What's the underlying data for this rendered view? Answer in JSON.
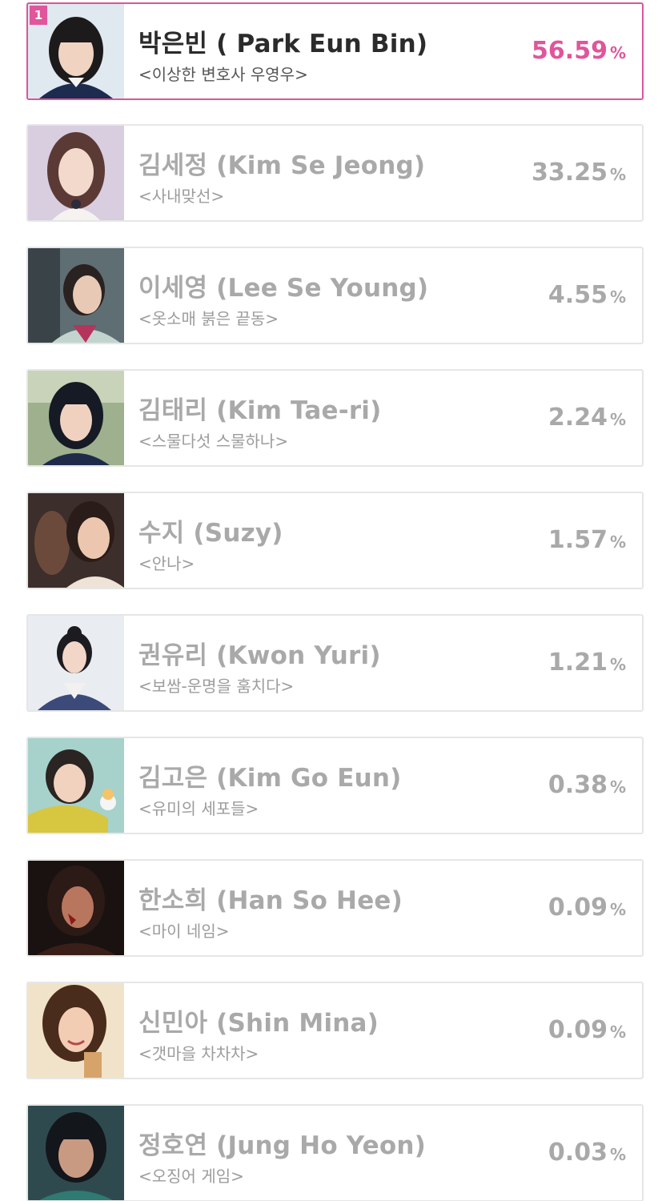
{
  "accent_color": "#e0559c",
  "rank_badge": "1",
  "entries": [
    {
      "name": "박은빈 ( Park Eun Bin)",
      "drama": "<이상한 변호사 우영우>",
      "percent": "56.59",
      "unit": "%",
      "photo": "photo-park-eun-bin"
    },
    {
      "name": "김세정 (Kim Se Jeong)",
      "drama": "<사내맞선>",
      "percent": "33.25",
      "unit": "%",
      "photo": "photo-kim-se-jeong"
    },
    {
      "name": "이세영 (Lee Se Young)",
      "drama": "<옷소매 붉은 끝동>",
      "percent": "4.55",
      "unit": "%",
      "photo": "photo-lee-se-young"
    },
    {
      "name": "김태리 (Kim Tae-ri)",
      "drama": "<스물다섯 스물하나>",
      "percent": "2.24",
      "unit": "%",
      "photo": "photo-kim-tae-ri"
    },
    {
      "name": "수지 (Suzy)",
      "drama": "<안나>",
      "percent": "1.57",
      "unit": "%",
      "photo": "photo-suzy"
    },
    {
      "name": "권유리 (Kwon Yuri)",
      "drama": "<보쌈-운명을 훔치다>",
      "percent": "1.21",
      "unit": "%",
      "photo": "photo-kwon-yuri"
    },
    {
      "name": "김고은 (Kim Go Eun)",
      "drama": "<유미의 세포들>",
      "percent": "0.38",
      "unit": "%",
      "photo": "photo-kim-go-eun"
    },
    {
      "name": "한소희 (Han So Hee)",
      "drama": "<마이 네임>",
      "percent": "0.09",
      "unit": "%",
      "photo": "photo-han-so-hee"
    },
    {
      "name": "신민아 (Shin Mina)",
      "drama": "<갯마을 차차차>",
      "percent": "0.09",
      "unit": "%",
      "photo": "photo-shin-mina"
    },
    {
      "name": "정호연 (Jung Ho Yeon)",
      "drama": "<오징어 게임>",
      "percent": "0.03",
      "unit": "%",
      "photo": "photo-jung-ho-yeon"
    }
  ]
}
